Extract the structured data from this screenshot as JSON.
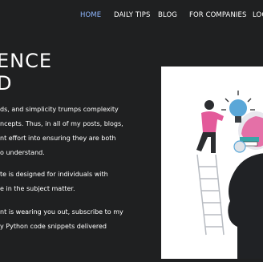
{
  "nav": {
    "items": [
      {
        "label": "HOME",
        "active": true
      },
      {
        "label": "DAILY TIPS",
        "active": false
      },
      {
        "label": "BLOG",
        "active": false
      },
      {
        "label": "FOR COMPANIES",
        "active": false
      },
      {
        "label": "LOG",
        "active": false
      }
    ],
    "active_color": "#8fb7ff"
  },
  "hero": {
    "heading_line1": "ENCE",
    "heading_line2": "D"
  },
  "paragraphs": [
    {
      "lines": [
        "ds, and simplicity trumps complexity",
        "ncepts. Thus, in all of my posts, blogs,",
        "nt effort into ensuring they are both",
        "o understand."
      ]
    },
    {
      "lines": [
        "te is designed for individuals with",
        "e in the subject matter."
      ]
    },
    {
      "lines": [
        "nt is wearing you out, subscribe to my",
        "y Python code snippets delivered"
      ]
    }
  ],
  "illustration": {
    "description_icon": "person-lightbulb-head-illustration"
  },
  "colors": {
    "background": "#1f2021",
    "accent": "#8fb7ff",
    "pink": "#e35a9a",
    "teal": "#3aa5a8"
  }
}
